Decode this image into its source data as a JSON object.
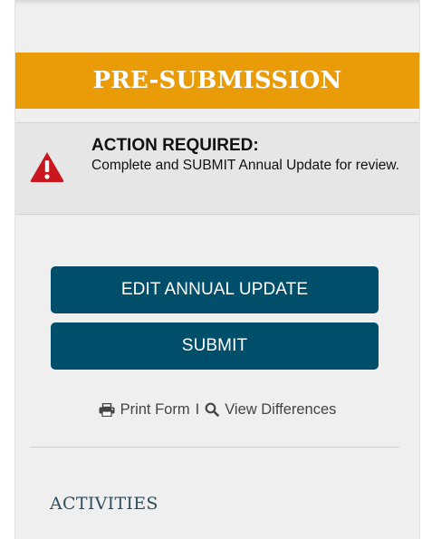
{
  "status_banner": {
    "label": "PRE-SUBMISSION"
  },
  "alert": {
    "icon": "warning-triangle-icon",
    "title": "ACTION REQUIRED:",
    "message": "Complete and SUBMIT Annual Update for review."
  },
  "actions": {
    "edit_label": "EDIT ANNUAL UPDATE",
    "submit_label": "SUBMIT"
  },
  "links": {
    "print_icon": "printer-icon",
    "print_label": "Print Form",
    "separator": "I",
    "diff_icon": "magnifier-icon",
    "diff_label": "View Differences"
  },
  "section": {
    "heading": "ACTIVITIES"
  },
  "colors": {
    "banner": "#e99b08",
    "button": "#004f6a",
    "alert_icon": "#c8181e",
    "panel_bg": "#efefef",
    "heading": "#2e4d5e"
  }
}
